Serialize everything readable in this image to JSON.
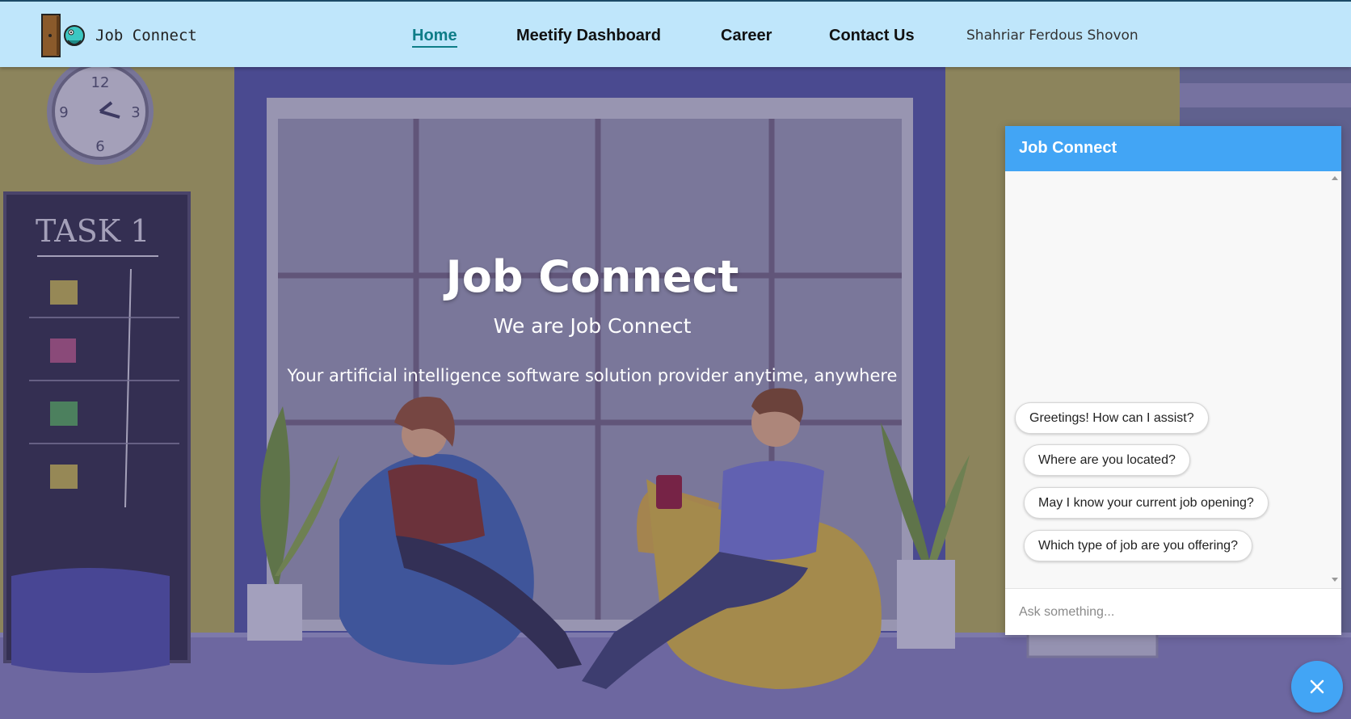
{
  "brand": {
    "name": "Job Connect",
    "logo_icon": "door-mascot-icon"
  },
  "nav": {
    "links": [
      {
        "label": "Home",
        "active": true
      },
      {
        "label": "Meetify Dashboard",
        "active": false
      },
      {
        "label": "Career",
        "active": false
      },
      {
        "label": "Contact Us",
        "active": false
      }
    ],
    "user_name": "Shahriar Ferdous Shovon"
  },
  "hero": {
    "title": "Job Connect",
    "subtitle": "We are Job Connect",
    "description": "Your artificial intelligence software solution provider anytime, anywhere"
  },
  "chat": {
    "title": "Job Connect",
    "suggestions": [
      "Greetings! How can I assist?",
      "Where are you located?",
      "May I know your current job opening?",
      "Which type of job are you offering?"
    ],
    "input_placeholder": "Ask something...",
    "close_icon": "close-icon"
  },
  "illustration": {
    "clock_numbers": [
      "12",
      "3",
      "6",
      "9"
    ],
    "board_text": "TASK 1"
  },
  "colors": {
    "navbar_bg": "#bfe6fb",
    "active_link": "#0e7d88",
    "chat_accent": "#42a5f5"
  }
}
